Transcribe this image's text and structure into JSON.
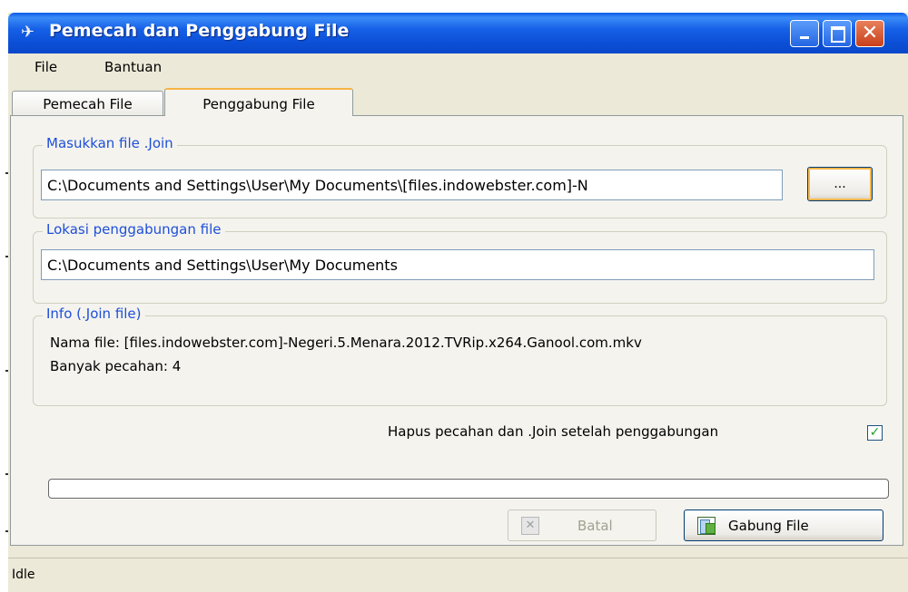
{
  "window": {
    "title": "Pemecah dan Penggabung File",
    "minimize_icon": "minimize-icon",
    "maximize_icon": "maximize-icon",
    "close_icon": "close-icon",
    "close_glyph": "✕"
  },
  "menu": {
    "items": [
      {
        "label": "File"
      },
      {
        "label": "Bantuan"
      }
    ]
  },
  "tabs": [
    {
      "label": "Pemecah File",
      "active": false
    },
    {
      "label": "Penggabung File",
      "active": true
    }
  ],
  "join_file": {
    "legend": "Masukkan file .Join",
    "value": "C:\\Documents and Settings\\User\\My Documents\\[files.indowebster.com]-N",
    "browse_label": "..."
  },
  "location": {
    "legend": "Lokasi penggabungan file",
    "value": "C:\\Documents and Settings\\User\\My Documents"
  },
  "info": {
    "legend": "Info (.Join file)",
    "file_name_line": "Nama file: [files.indowebster.com]-Negeri.5.Menara.2012.TVRip.x264.Ganool.com.mkv",
    "pieces_line": "Banyak pecahan: 4"
  },
  "options": {
    "delete_label": "Hapus pecahan dan .Join setelah penggabungan",
    "delete_checked": true,
    "check_glyph": "✓"
  },
  "progress": {
    "fraction": 0.0
  },
  "buttons": {
    "cancel_label": "Batal",
    "cancel_icon_glyph": "✕",
    "join_label": "Gabung File"
  },
  "status": {
    "text": "Idle"
  },
  "colors": {
    "titlebar": "#0b4fd6",
    "legend_text": "#1e4fd8",
    "check": "#21a121"
  }
}
